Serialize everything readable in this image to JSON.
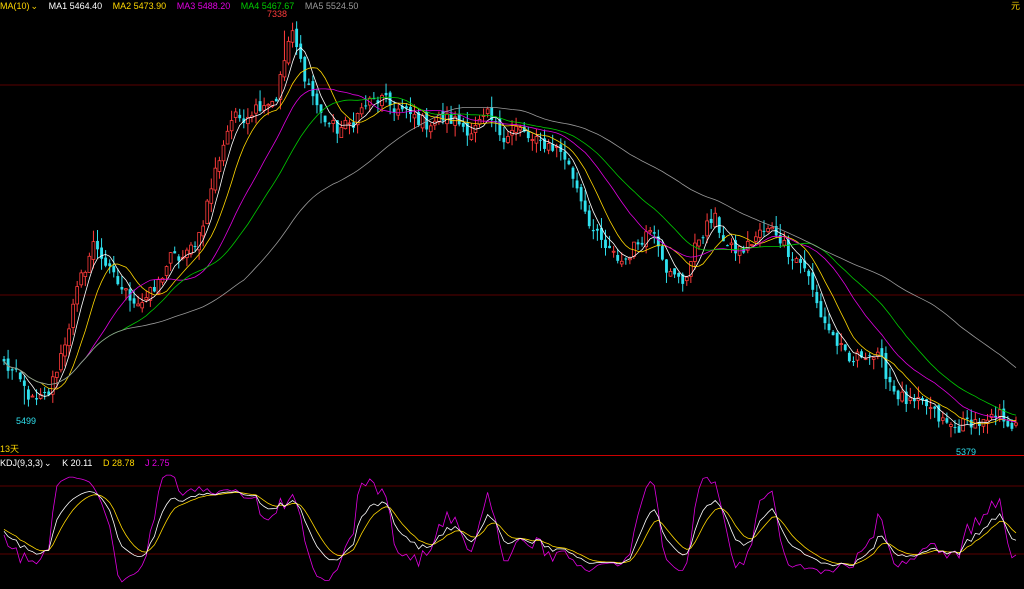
{
  "colors": {
    "up": "#ff3b3b",
    "down": "#2fe0ee",
    "ma1": "#ffffff",
    "ma2": "#ffd700",
    "ma3": "#e000e0",
    "ma4": "#00cc00",
    "ma5": "#999999",
    "k": "#ffffff",
    "d": "#ffd700",
    "j": "#e000e0",
    "grid": "#6a0000",
    "separator": "#cc0000"
  },
  "ma_legend": {
    "indicator": "MA(10)",
    "dropdown_icon": "chevron-down-icon",
    "ma1": "MA1 5464.40",
    "ma2": "MA2 5473.90",
    "ma3": "MA3 5488.20",
    "ma4": "MA4 5467.67",
    "ma5": "MA5 5524.50"
  },
  "kdj_legend": {
    "indicator": "KDJ(9,3,3)",
    "dropdown_icon": "chevron-down-icon",
    "k": "K 20.11",
    "d": "D 28.78",
    "j": "J 2.75"
  },
  "labels": {
    "high": "7338",
    "low_left": "5499",
    "low_right": "5379",
    "period": "13天",
    "corner": "元"
  },
  "chart_data": [
    {
      "type": "candlestick",
      "title": "",
      "series_names": [
        "MA1",
        "MA2",
        "MA3",
        "MA4",
        "MA5"
      ],
      "ylim": [
        5300,
        7400
      ],
      "grid": true,
      "highest": 7338,
      "lowest": 5379,
      "close_path": [
        5700,
        5620,
        5500,
        5560,
        5800,
        6100,
        6300,
        6150,
        6050,
        6000,
        6060,
        6220,
        6220,
        6350,
        6650,
        6900,
        6920,
        6980,
        7000,
        7338,
        7100,
        6920,
        6850,
        6880,
        6980,
        7000,
        6950,
        6920,
        6880,
        6910,
        6890,
        6840,
        6920,
        6820,
        6860,
        6790,
        6780,
        6740,
        6560,
        6350,
        6250,
        6200,
        6300,
        6380,
        6140,
        6100,
        6320,
        6420,
        6260,
        6260,
        6340,
        6360,
        6250,
        6180,
        5950,
        5820,
        5700,
        5760,
        5720,
        5560,
        5500,
        5500,
        5420,
        5380,
        5420,
        5400,
        5450,
        5380
      ]
    },
    {
      "type": "line",
      "title": "",
      "series_names": [
        "K",
        "D",
        "J"
      ],
      "ylim": [
        -20,
        120
      ],
      "grid": true
    }
  ]
}
